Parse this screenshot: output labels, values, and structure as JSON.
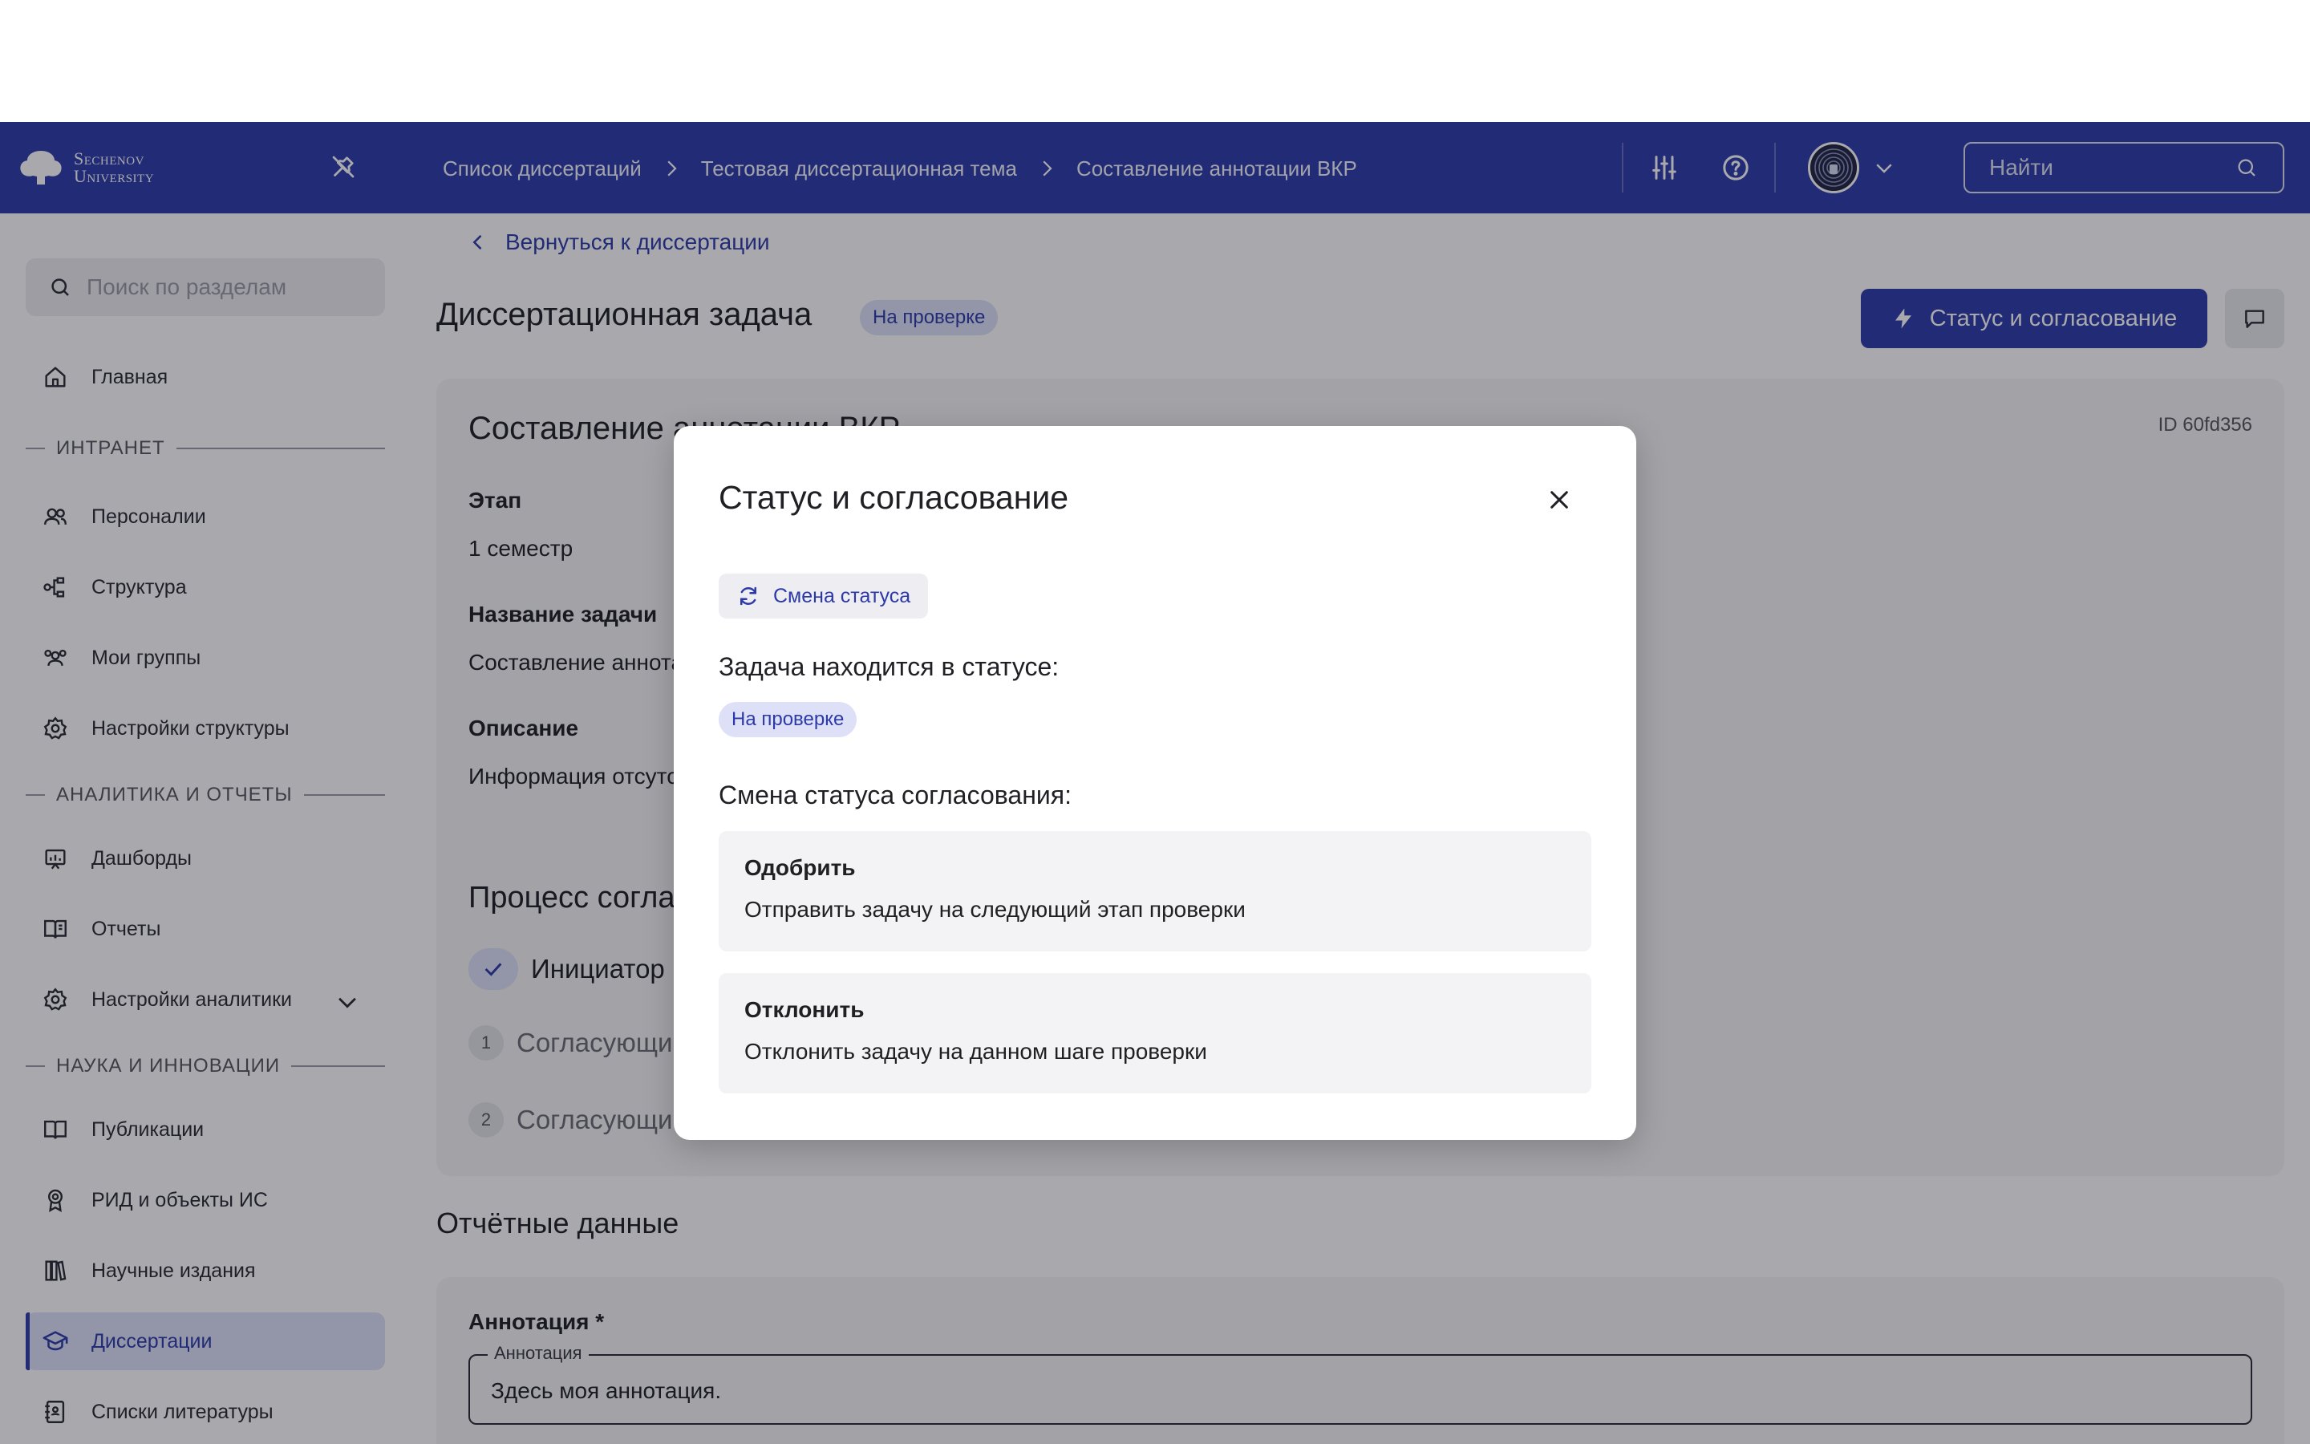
{
  "header": {
    "logo_line1": "Sechenov",
    "logo_line2": "University",
    "breadcrumbs": [
      "Список диссертаций",
      "Тестовая диссертационная тема",
      "Составление аннотации ВКР"
    ],
    "search_placeholder": "Найти",
    "icons": [
      "pin-off-icon",
      "filters-icon",
      "help-icon",
      "avatar",
      "chevron-down-icon",
      "search-icon"
    ]
  },
  "sidebar": {
    "search_placeholder": "Поиск по разделам",
    "items": [
      {
        "label": "Главная",
        "icon": "home-icon"
      },
      {
        "label": "Персоналии",
        "icon": "users-icon"
      },
      {
        "label": "Структура",
        "icon": "structure-icon"
      },
      {
        "label": "Мои группы",
        "icon": "groups-icon"
      },
      {
        "label": "Настройки структуры",
        "icon": "gear-icon"
      },
      {
        "label": "Дашборды",
        "icon": "dashboard-icon"
      },
      {
        "label": "Отчеты",
        "icon": "book-icon"
      },
      {
        "label": "Настройки аналитики",
        "icon": "gear-icon"
      },
      {
        "label": "Публикации",
        "icon": "book-open-icon"
      },
      {
        "label": "РИД и объекты ИС",
        "icon": "award-icon"
      },
      {
        "label": "Научные издания",
        "icon": "library-icon"
      },
      {
        "label": "Диссертации",
        "icon": "graduation-cap-icon"
      },
      {
        "label": "Списки литературы",
        "icon": "notebook-icon"
      }
    ],
    "sections": [
      "ИНТРАНЕТ",
      "АНАЛИТИКА И ОТЧЕТЫ",
      "НАУКА И ИННОВАЦИИ"
    ],
    "active_item": "Диссертации"
  },
  "main": {
    "back_link": "Вернуться к диссертации",
    "title": "Диссертационная задача",
    "status_badge": "На проверке",
    "status_button": "Статус и согласование",
    "card": {
      "title": "Составление аннотации ВКР",
      "id": "ID 60fd356",
      "stage_label": "Этап",
      "stage_value": "1 семестр",
      "task_name_label": "Название задачи",
      "task_name_value": "Составление аннотации ВКР",
      "description_label": "Описание",
      "description_value": "Информация отсутствует",
      "process_title": "Процесс согласования",
      "steps": [
        {
          "marker": "",
          "label": "Инициатор"
        },
        {
          "marker": "1",
          "label": "Согласующий"
        },
        {
          "marker": "2",
          "label": "Согласующий"
        }
      ]
    },
    "report_title": "Отчётные данные",
    "annotation": {
      "label": "Аннотация *",
      "legend": "Аннотация",
      "value": "Здесь моя аннотация."
    }
  },
  "modal": {
    "title": "Статус и согласование",
    "chip": "Смена статуса",
    "current_status_heading": "Задача находится в статусе:",
    "current_status": "На проверке",
    "change_heading": "Смена статуса согласования:",
    "options": [
      {
        "title": "Одобрить",
        "description": "Отправить задачу на следующий этап проверки"
      },
      {
        "title": "Отклонить",
        "description": "Отклонить задачу на данном шаге проверки"
      }
    ]
  },
  "colors": {
    "brand": "#2c3aa8",
    "badge_bg": "#dde0f7",
    "overlay": "rgba(18,18,28,0.36)"
  }
}
